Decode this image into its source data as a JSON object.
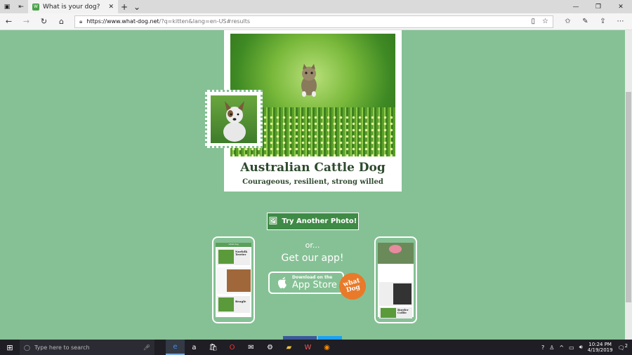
{
  "browser": {
    "tab_title": "What is your dog?",
    "tab_close": "✕",
    "new_tab": "+",
    "tab_menu": "⌄",
    "url_host": "https://www.what-dog.net",
    "url_path": "/?q=kitten&lang=en-US#results",
    "window_controls": [
      "—",
      "❐",
      "✕"
    ]
  },
  "result": {
    "breed": "Australian Cattle Dog",
    "traits": "Courageous, resilient, strong willed"
  },
  "actions": {
    "try_label": "Try Another Photo!",
    "or_label": "or...",
    "get_app_label": "Get our app!",
    "appstore_small": "Download on the",
    "appstore_big": "App Store",
    "badge_label": "what Dog"
  },
  "phones": {
    "left_header": "what-dog",
    "left_items": [
      {
        "name": "Norfolk Terrier"
      },
      {
        "name": "Beagle"
      }
    ],
    "right_items": [
      {
        "name": "Border Collie"
      }
    ]
  },
  "taskbar": {
    "search_placeholder": "Type here to search",
    "time": "10:24 PM",
    "date": "4/19/2019",
    "notification_count": "2"
  }
}
